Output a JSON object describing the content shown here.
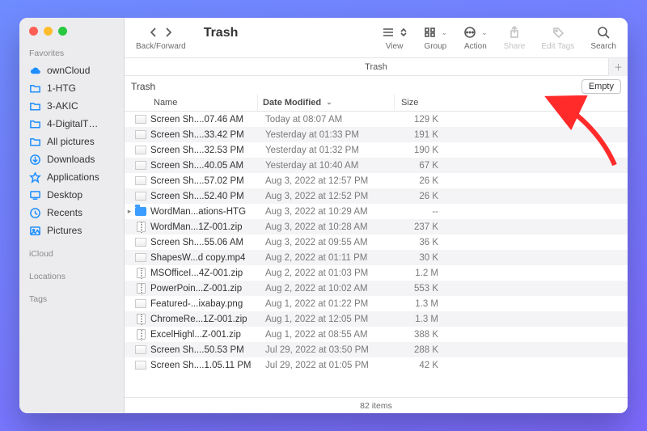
{
  "toolbar": {
    "backForward": "Back/Forward",
    "title": "Trash",
    "view": "View",
    "group": "Group",
    "action": "Action",
    "share": "Share",
    "editTags": "Edit Tags",
    "search": "Search"
  },
  "pathbar": {
    "label": "Trash"
  },
  "location": {
    "name": "Trash",
    "emptyLabel": "Empty"
  },
  "columns": {
    "name": "Name",
    "date": "Date Modified",
    "size": "Size"
  },
  "status": {
    "count": "82 items"
  },
  "sidebar": {
    "sections": {
      "favorites": "Favorites",
      "icloud": "iCloud",
      "locations": "Locations",
      "tags": "Tags"
    },
    "items": [
      {
        "icon": "cloud",
        "label": "ownCloud"
      },
      {
        "icon": "folder",
        "label": "1-HTG"
      },
      {
        "icon": "folder",
        "label": "3-AKIC"
      },
      {
        "icon": "folder",
        "label": "4-DigitalT…"
      },
      {
        "icon": "folder",
        "label": "All pictures"
      },
      {
        "icon": "download",
        "label": "Downloads"
      },
      {
        "icon": "apps",
        "label": "Applications"
      },
      {
        "icon": "desktop",
        "label": "Desktop"
      },
      {
        "icon": "recent",
        "label": "Recents"
      },
      {
        "icon": "pictures",
        "label": "Pictures"
      }
    ]
  },
  "files": [
    {
      "icon": "thumb",
      "name": "Screen Sh....07.46 AM",
      "date": "Today at 08:07 AM",
      "size": "129 K",
      "expand": false
    },
    {
      "icon": "thumb",
      "name": "Screen Sh....33.42 PM",
      "date": "Yesterday at 01:33 PM",
      "size": "191 K",
      "expand": false
    },
    {
      "icon": "thumb",
      "name": "Screen Sh....32.53 PM",
      "date": "Yesterday at 01:32 PM",
      "size": "190 K",
      "expand": false
    },
    {
      "icon": "thumb",
      "name": "Screen Sh....40.05 AM",
      "date": "Yesterday at 10:40 AM",
      "size": "67 K",
      "expand": false
    },
    {
      "icon": "thumb",
      "name": "Screen Sh....57.02 PM",
      "date": "Aug 3, 2022 at 12:57 PM",
      "size": "26 K",
      "expand": false
    },
    {
      "icon": "thumb",
      "name": "Screen Sh....52.40 PM",
      "date": "Aug 3, 2022 at 12:52 PM",
      "size": "26 K",
      "expand": false
    },
    {
      "icon": "folder",
      "name": "WordMan...ations-HTG",
      "date": "Aug 3, 2022 at 10:29 AM",
      "size": "--",
      "expand": true
    },
    {
      "icon": "zip",
      "name": "WordMan...1Z-001.zip",
      "date": "Aug 3, 2022 at 10:28 AM",
      "size": "237 K",
      "expand": false
    },
    {
      "icon": "thumb",
      "name": "Screen Sh....55.06 AM",
      "date": "Aug 3, 2022 at 09:55 AM",
      "size": "36 K",
      "expand": false
    },
    {
      "icon": "thumb",
      "name": "ShapesW...d copy.mp4",
      "date": "Aug 2, 2022 at 01:11 PM",
      "size": "30 K",
      "expand": false
    },
    {
      "icon": "zip",
      "name": "MSOfficeI...4Z-001.zip",
      "date": "Aug 2, 2022 at 01:03 PM",
      "size": "1.2 M",
      "expand": false
    },
    {
      "icon": "zip",
      "name": "PowerPoin...Z-001.zip",
      "date": "Aug 2, 2022 at 10:02 AM",
      "size": "553 K",
      "expand": false
    },
    {
      "icon": "thumb",
      "name": "Featured-...ixabay.png",
      "date": "Aug 1, 2022 at 01:22 PM",
      "size": "1.3 M",
      "expand": false
    },
    {
      "icon": "zip",
      "name": "ChromeRe...1Z-001.zip",
      "date": "Aug 1, 2022 at 12:05 PM",
      "size": "1.3 M",
      "expand": false
    },
    {
      "icon": "zip",
      "name": "ExcelHighl...Z-001.zip",
      "date": "Aug 1, 2022 at 08:55 AM",
      "size": "388 K",
      "expand": false
    },
    {
      "icon": "thumb",
      "name": "Screen Sh....50.53 PM",
      "date": "Jul 29, 2022 at 03:50 PM",
      "size": "288 K",
      "expand": false
    },
    {
      "icon": "thumb",
      "name": "Screen Sh....1.05.11 PM",
      "date": "Jul 29, 2022 at 01:05 PM",
      "size": "42 K",
      "expand": false
    }
  ]
}
